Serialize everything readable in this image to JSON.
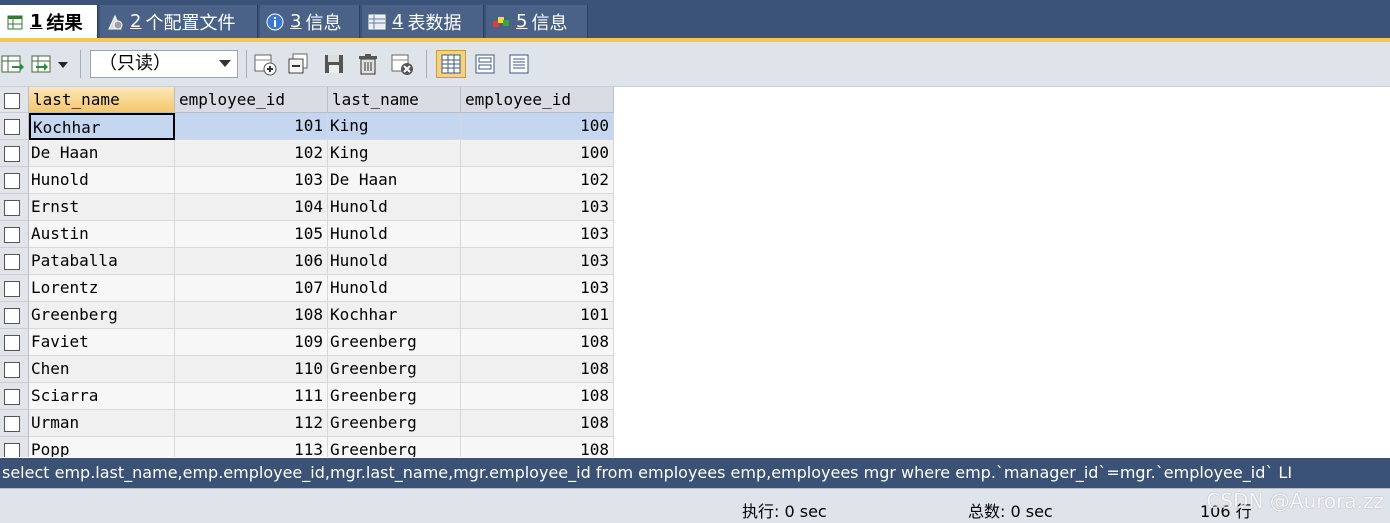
{
  "tabs": [
    {
      "num": "1",
      "label": "结果",
      "icon": "results-grid-icon",
      "active": true
    },
    {
      "num": "2",
      "label": "个配置文件",
      "icon": "profile-icon",
      "active": false
    },
    {
      "num": "3",
      "label": "信息",
      "icon": "info-icon",
      "active": false
    },
    {
      "num": "4",
      "label": "表数据",
      "icon": "table-data-icon",
      "active": false
    },
    {
      "num": "5",
      "label": "信息",
      "icon": "info-blocks-icon",
      "active": false
    }
  ],
  "toolbar": {
    "mode_select_value": "（只读）"
  },
  "grid": {
    "columns": [
      "last_name",
      "employee_id",
      "last_name",
      "employee_id"
    ],
    "rows": [
      [
        "Kochhar",
        "101",
        "King",
        "100"
      ],
      [
        "De Haan",
        "102",
        "King",
        "100"
      ],
      [
        "Hunold",
        "103",
        "De Haan",
        "102"
      ],
      [
        "Ernst",
        "104",
        "Hunold",
        "103"
      ],
      [
        "Austin",
        "105",
        "Hunold",
        "103"
      ],
      [
        "Pataballa",
        "106",
        "Hunold",
        "103"
      ],
      [
        "Lorentz",
        "107",
        "Hunold",
        "103"
      ],
      [
        "Greenberg",
        "108",
        "Kochhar",
        "101"
      ],
      [
        "Faviet",
        "109",
        "Greenberg",
        "108"
      ],
      [
        "Chen",
        "110",
        "Greenberg",
        "108"
      ],
      [
        "Sciarra",
        "111",
        "Greenberg",
        "108"
      ],
      [
        "Urman",
        "112",
        "Greenberg",
        "108"
      ],
      [
        "Popp",
        "113",
        "Greenberg",
        "108"
      ]
    ]
  },
  "sql": "select emp.last_name,emp.employee_id,mgr.last_name,mgr.employee_id from employees emp,employees mgr where emp.`manager_id`=mgr.`employee_id` LI",
  "status": {
    "exec_label": "执行: 0 sec",
    "total_label": "总数: 0 sec",
    "rows_label": "106 行"
  },
  "watermark": "CSDN @Aurora.zz"
}
